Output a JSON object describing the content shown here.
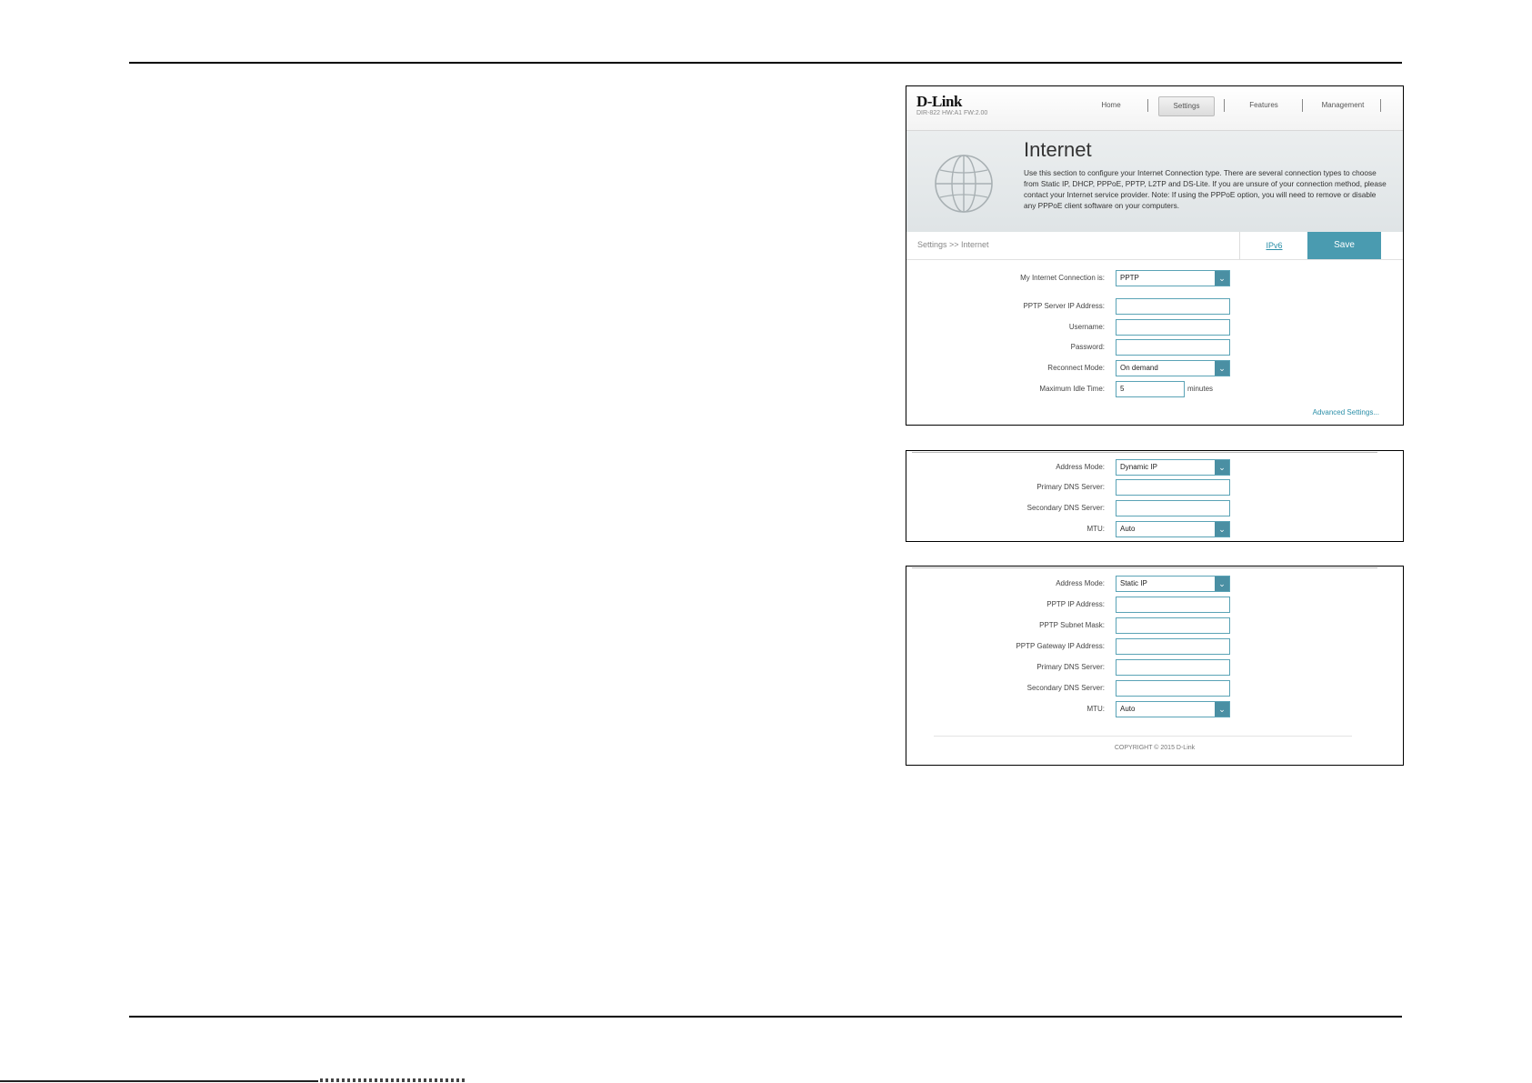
{
  "header": {
    "logo": "D-Link",
    "firmware": "DIR-822 HW:A1 FW:2.00",
    "nav": [
      "Home",
      "Settings",
      "Features",
      "Management"
    ]
  },
  "banner": {
    "title": "Internet",
    "description": "Use this section to configure your Internet Connection type. There are several connection types to choose from Static IP, DHCP, PPPoE, PPTP, L2TP and DS-Lite. If you are unsure of your connection method, please contact your Internet service provider. Note: If using the PPPoE option, you will need to remove or disable any PPPoE client software on your computers."
  },
  "toolbar": {
    "breadcrumb": "Settings >> Internet",
    "ipv6_label": "IPv6",
    "save_label": "Save"
  },
  "pptp_form": {
    "connection_label": "My Internet Connection is:",
    "connection_value": "PPTP",
    "server_ip_label": "PPTP Server IP Address:",
    "server_ip_value": "",
    "username_label": "Username:",
    "username_value": "",
    "password_label": "Password:",
    "password_value": "",
    "reconnect_label": "Reconnect Mode:",
    "reconnect_value": "On demand",
    "idle_label": "Maximum Idle Time:",
    "idle_value": "5",
    "idle_unit": "minutes",
    "advanced_link": "Advanced Settings..."
  },
  "dynamic_form": {
    "address_mode_label": "Address Mode:",
    "address_mode_value": "Dynamic IP",
    "primary_dns_label": "Primary DNS Server:",
    "primary_dns_value": "",
    "secondary_dns_label": "Secondary DNS Server:",
    "secondary_dns_value": "",
    "mtu_label": "MTU:",
    "mtu_value": "Auto"
  },
  "static_form": {
    "address_mode_label": "Address Mode:",
    "address_mode_value": "Static IP",
    "ip_label": "PPTP IP Address:",
    "ip_value": "",
    "subnet_label": "PPTP Subnet Mask:",
    "subnet_value": "",
    "gateway_label": "PPTP Gateway IP Address:",
    "gateway_value": "",
    "primary_dns_label": "Primary DNS Server:",
    "primary_dns_value": "",
    "secondary_dns_label": "Secondary DNS Server:",
    "secondary_dns_value": "",
    "mtu_label": "MTU:",
    "mtu_value": "Auto"
  },
  "footer": {
    "copyright": "COPYRIGHT © 2015 D-Link"
  },
  "colors": {
    "accent": "#4a9bb0",
    "link": "#2c8fa8",
    "field_border": "#5aa3b6"
  }
}
